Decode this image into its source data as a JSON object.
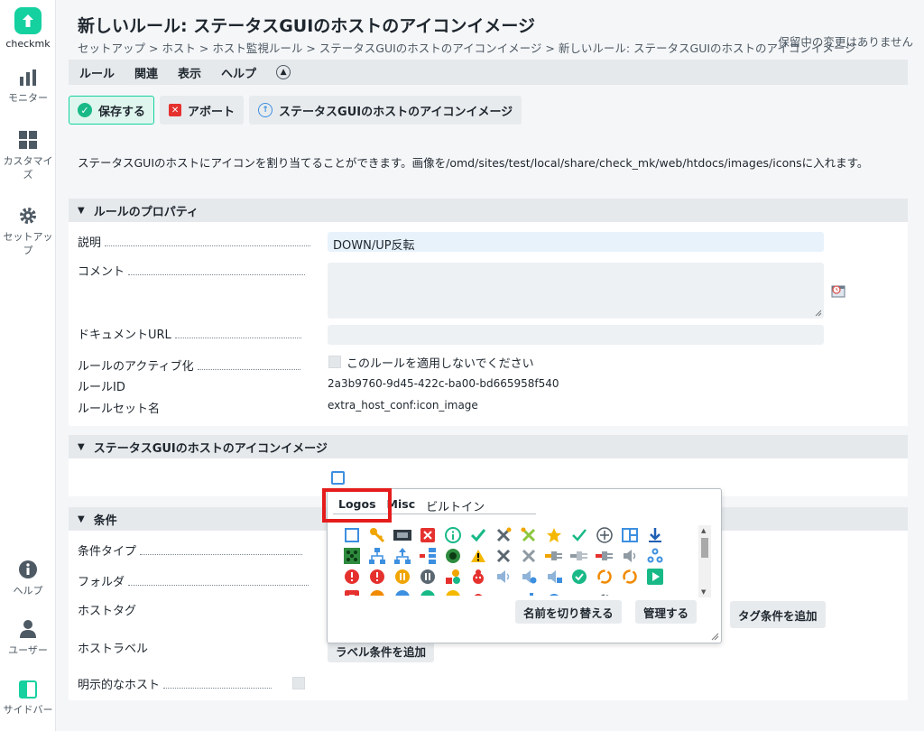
{
  "app": {
    "brand": "checkmk"
  },
  "sidebar": {
    "items": [
      {
        "label": "モニター",
        "icon": "chart-icon"
      },
      {
        "label": "カスタマイズ",
        "icon": "grid-icon"
      },
      {
        "label": "セットアップ",
        "icon": "gear-icon"
      },
      {
        "label": "ヘルプ",
        "icon": "info-icon"
      },
      {
        "label": "ユーザー",
        "icon": "user-icon"
      },
      {
        "label": "サイドバー",
        "icon": "sidebar-icon"
      }
    ]
  },
  "header": {
    "title": "新しいルール: ステータスGUIのホストのアイコンイメージ",
    "breadcrumb": "セットアップ > ホスト > ホスト監視ルール > ステータスGUIのホストのアイコンイメージ > 新しいルール: ステータスGUIのホストのアイコンイメージ",
    "pending": "保留中の変更はありません"
  },
  "menu": {
    "items": [
      "ルール",
      "関連",
      "表示",
      "ヘルプ"
    ]
  },
  "toolbar": {
    "save": "保存する",
    "abort": "アボート",
    "ruleset": "ステータスGUIのホストのアイコンイメージ"
  },
  "help_text": "ステータスGUIのホストにアイコンを割り当てることができます。画像を/omd/sites/test/local/share/check_mk/web/htdocs/images/iconsに入れます。",
  "properties": {
    "heading": "ルールのプロパティ",
    "description_label": "説明",
    "description_value": "DOWN/UP反転",
    "comment_label": "コメント",
    "doc_url_label": "ドキュメントURL",
    "activation_label": "ルールのアクティブ化",
    "activation_checkbox": "このルールを適用しないでください",
    "rule_id_label": "ルールID",
    "rule_id_value": "2a3b9760-9d45-422c-ba00-bd665958f540",
    "ruleset_label": "ルールセット名",
    "ruleset_value": "extra_host_conf:icon_image"
  },
  "icon_section": {
    "heading": "ステータスGUIのホストのアイコンイメージ"
  },
  "icon_picker": {
    "tabs": [
      "Logos",
      "Misc",
      "ビルトイン"
    ],
    "toggle_names_button": "名前を切り替える",
    "manage_button": "管理する"
  },
  "conditions": {
    "heading": "条件",
    "condition_type_label": "条件タイプ",
    "folder_label": "フォルダ",
    "host_tags_label": "ホストタグ",
    "add_tag_button": "タグ条件を追加",
    "host_labels_label": "ホストラベル",
    "add_label_button": "ラベル条件を追加",
    "explicit_hosts_label": "明示的なホスト"
  }
}
